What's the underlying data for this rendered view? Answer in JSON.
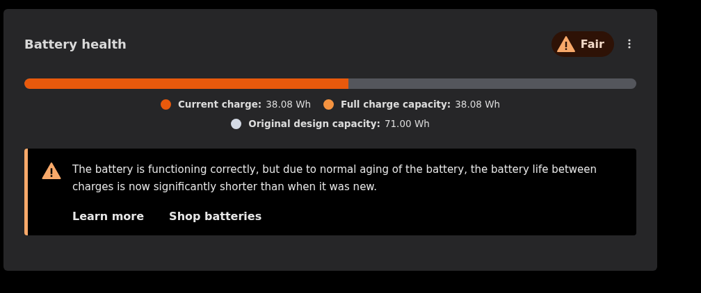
{
  "card": {
    "title": "Battery health",
    "status": {
      "label": "Fair"
    },
    "bar": {
      "level": 0.53
    },
    "legend": [
      {
        "label": "Current charge:",
        "value": "38.08 Wh",
        "color": "#e8590c"
      },
      {
        "label": "Full charge capacity:",
        "value": "38.08 Wh",
        "color": "#f59340"
      },
      {
        "label": "Original design capacity:",
        "value": "71.00 Wh",
        "color": "#d5dbe6"
      }
    ],
    "message": {
      "text": "The battery is functioning correctly, but due to normal aging of the battery, the battery life between charges is now significantly shorter than when it was new.",
      "links": [
        "Learn more",
        "Shop batteries"
      ]
    }
  }
}
